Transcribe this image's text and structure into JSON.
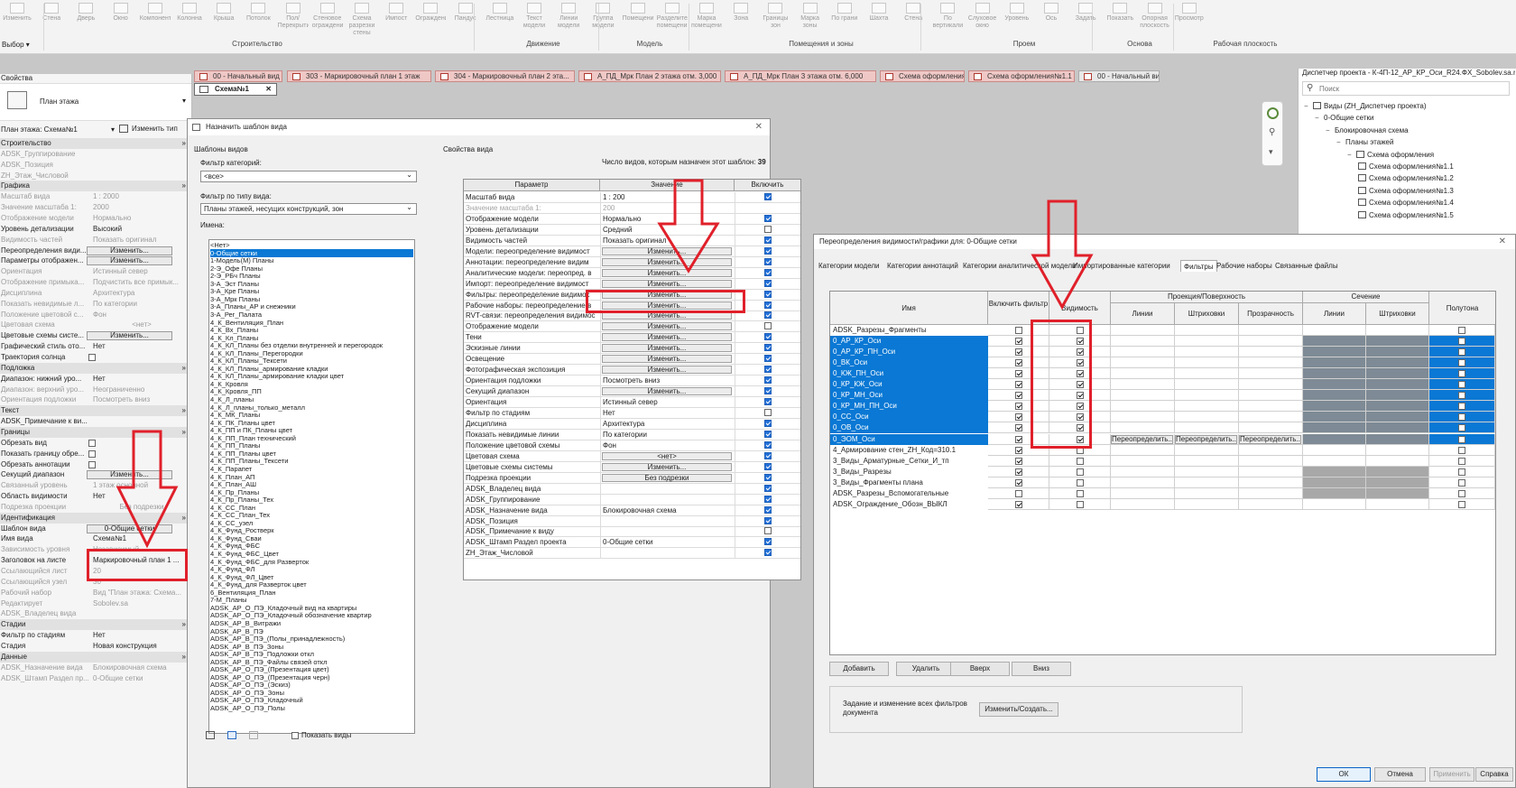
{
  "ribbon": {
    "tools": [
      "Изменить",
      "Стена",
      "Дверь",
      "Окно",
      "Компонент",
      "Колонна",
      "Крыша",
      "Потолок",
      "Пол/Перекрытие",
      "Стеновое ограждение",
      "Схема разрезки стены",
      "Импост",
      "Ограждение",
      "Пандус",
      "Лестница",
      "Текст модели",
      "Линии модели",
      "Группа модели",
      "Помещение",
      "Разделитель помещений",
      "Марка помещения",
      "Зона",
      "Границы зон",
      "Марка зоны",
      "По грани",
      "Шахта",
      "Стена",
      "По вертикали",
      "Слуховое окно",
      "Уровень",
      "Ось",
      "Задать",
      "Показать",
      "Опорная плоскость",
      "Просмотр"
    ],
    "select_label": "Выбор",
    "panels": [
      "Строительство",
      "Движение",
      "Модель",
      "Помещения и зоны",
      "Проем",
      "Основа",
      "Рабочая плоскость"
    ]
  },
  "tabs": [
    "00 - Начальный вид",
    "303 - Маркировочный план 1 этаж",
    "304 - Маркировочный план 2 эта...",
    "А_ПД_Мрк План 2 этажа отм. 3,000",
    "А_ПД_Мрк План 3 этажа отм. 6,000",
    "Схема оформления",
    "Схема оформления№1.1",
    "00 - Начальный вид"
  ],
  "active_tab": "Схема№1",
  "properties": {
    "title": "Свойства",
    "type_name": "План этажа",
    "instance_label": "План этажа: Схема№1",
    "edit_type": "Изменить тип",
    "rows": [
      {
        "t": "sec",
        "k": "Строительство"
      },
      {
        "t": "row",
        "k": "ADSK_Группирование",
        "v": "",
        "dis": true
      },
      {
        "t": "row",
        "k": "ADSK_Позиция",
        "v": "",
        "dis": true
      },
      {
        "t": "row",
        "k": "ZH_Этаж_Числовой",
        "v": "",
        "dis": true
      },
      {
        "t": "sec",
        "k": "Графика"
      },
      {
        "t": "row",
        "k": "Масштаб вида",
        "v": "1 : 2000",
        "dis": true
      },
      {
        "t": "row",
        "k": "Значение масштаба    1:",
        "v": "2000",
        "dis": true
      },
      {
        "t": "row",
        "k": "Отображение модели",
        "v": "Нормально",
        "dis": true
      },
      {
        "t": "row",
        "k": "Уровень детализации",
        "v": "Высокий",
        "dis": false
      },
      {
        "t": "row",
        "k": "Видимость частей",
        "v": "Показать оригинал",
        "dis": true
      },
      {
        "t": "btn",
        "k": "Переопределения види...",
        "v": "Изменить..."
      },
      {
        "t": "btn",
        "k": "Параметры отображен...",
        "v": "Изменить..."
      },
      {
        "t": "row",
        "k": "Ориентация",
        "v": "Истинный север",
        "dis": true
      },
      {
        "t": "row",
        "k": "Отображение примыка...",
        "v": "Подчистить все примык...",
        "dis": true
      },
      {
        "t": "row",
        "k": "Дисциплина",
        "v": "Архитектура",
        "dis": true
      },
      {
        "t": "row",
        "k": "Показать невидимые л...",
        "v": "По категории",
        "dis": true
      },
      {
        "t": "row",
        "k": "Положение цветовой с...",
        "v": "Фон",
        "dis": true
      },
      {
        "t": "row",
        "k": "Цветовая схема",
        "v": "<нет>",
        "dis": true,
        "center": true
      },
      {
        "t": "btn",
        "k": "Цветовые схемы систе...",
        "v": "Изменить..."
      },
      {
        "t": "row",
        "k": "Графический стиль отo...",
        "v": "Нет",
        "dis": false
      },
      {
        "t": "chk",
        "k": "Траектория солнца",
        "v": ""
      },
      {
        "t": "sec",
        "k": "Подложка"
      },
      {
        "t": "row",
        "k": "Диапазон: нижний уро...",
        "v": "Нет",
        "dis": false
      },
      {
        "t": "row",
        "k": "Диапазон: верхний уро...",
        "v": "Неограниченно",
        "dis": true
      },
      {
        "t": "row",
        "k": "Ориентация подложки",
        "v": "Посмотреть вниз",
        "dis": true
      },
      {
        "t": "sec",
        "k": "Текст"
      },
      {
        "t": "row",
        "k": "ADSK_Примечание к ви...",
        "v": "",
        "dis": false
      },
      {
        "t": "sec",
        "k": "Границы"
      },
      {
        "t": "chk",
        "k": "Обрезать вид",
        "v": ""
      },
      {
        "t": "chk",
        "k": "Показать границу обре...",
        "v": ""
      },
      {
        "t": "chk",
        "k": "Обрезать аннотации",
        "v": ""
      },
      {
        "t": "btn",
        "k": "Секущий диапазон",
        "v": "Изменить..."
      },
      {
        "t": "row",
        "k": "Связанный уровень",
        "v": "1 этаж основной",
        "dis": true
      },
      {
        "t": "row",
        "k": "Область видимости",
        "v": "Нет",
        "dis": false
      },
      {
        "t": "row",
        "k": "Подрезка проекции",
        "v": "Без подрезки",
        "dis": true,
        "center": true
      },
      {
        "t": "sec",
        "k": "Идентификация"
      },
      {
        "t": "btn",
        "k": "Шаблон вида",
        "v": "0-Общие сетки"
      },
      {
        "t": "row",
        "k": "Имя вида",
        "v": "Схема№1",
        "dis": false
      },
      {
        "t": "row",
        "k": "Зависимость уровня",
        "v": "Независимый",
        "dis": true
      },
      {
        "t": "row",
        "k": "Заголовок на листе",
        "v": "Маркировочный план 1 ...",
        "dis": false
      },
      {
        "t": "row",
        "k": "Ссылающийся лист",
        "v": "20",
        "dis": true
      },
      {
        "t": "row",
        "k": "Ссылающийся узел",
        "v": "30",
        "dis": true
      },
      {
        "t": "row",
        "k": "Рабочий набор",
        "v": "Вид \"План этажа: Схема...",
        "dis": true
      },
      {
        "t": "row",
        "k": "Редактирует",
        "v": "Sobolev.sa",
        "dis": true
      },
      {
        "t": "row",
        "k": "ADSK_Владелец вида",
        "v": "",
        "dis": true
      },
      {
        "t": "sec",
        "k": "Стадии"
      },
      {
        "t": "row",
        "k": "Фильтр по стадиям",
        "v": "Нет",
        "dis": false
      },
      {
        "t": "row",
        "k": "Стадия",
        "v": "Новая конструкция",
        "dis": false
      },
      {
        "t": "sec",
        "k": "Данные"
      },
      {
        "t": "row",
        "k": "ADSK_Назначение вида",
        "v": "Блокировочная схема",
        "dis": true
      },
      {
        "t": "row",
        "k": "ADSK_Штамп Раздел пр...",
        "v": "0-Общие сетки",
        "dis": true
      }
    ]
  },
  "dialog_template": {
    "title": "Назначить шаблон вида",
    "templates_label": "Шаблоны видов",
    "filter_cat_label": "Фильтр категорий:",
    "filter_cat_value": "<все>",
    "filter_type_label": "Фильтр по типу вида:",
    "filter_type_value": "Планы этажей, несущих конструкций, зон",
    "names_label": "Имена:",
    "names": [
      "<Нет>",
      "0-Общие сетки",
      "1-Модель(М) Планы",
      "2-Э_Офе Планы",
      "2-Э_РБч Планы",
      "3-А_Эст Планы",
      "3-А_Кре Планы",
      "3-А_Мрк Планы",
      "3-А_Планы_АР и снежники",
      "3-А_Рег_Палата",
      "4_К_Вентиляция_План",
      "4_К_Вх_Планы",
      "4_К_Кл_Планы",
      "4_К_КЛ_Планы без отделки внутренней и перегородок",
      "4_К_КЛ_Планы_Перегородки",
      "4_К_КЛ_Планы_Тексети",
      "4_К_КЛ_Планы_армирование кладки",
      "4_К_КЛ_Планы_армирование кладки цвет",
      "4_К_Кровля",
      "4_К_Кровля_ПП",
      "4_К_Л_планы",
      "4_К_Л_планы_только_металл",
      "4_К_МК_Планы",
      "4_К_ПК_Планы цвет",
      "4_К_ПП и ПК_Планы цвет",
      "4_К_ПП_План технический",
      "4_К_ПП_Планы",
      "4_К_ПП_Планы цвет",
      "4_К_ПП_Планы_Тексети",
      "4_К_Парапет",
      "4_К_План_АП",
      "4_К_План_АШ",
      "4_К_Пр_Планы",
      "4_К_Пр_Планы_Тех",
      "4_К_СС_План",
      "4_К_СС_План_Тех",
      "4_К_СС_узел",
      "4_К_Фунд_Ростверк",
      "4_К_Фунд_Сваи",
      "4_К_Фунд_ФБС",
      "4_К_Фунд_ФБС_Цвет",
      "4_К_Фунд_ФБС_для Разверток",
      "4_К_Фунд_ФЛ",
      "4_К_Фунд_ФЛ_Цвет",
      "4_К_Фунд_для Разверток цвет",
      "6_Вентиляция_План",
      "7-М_Планы",
      "ADSK_АР_О_ПЭ_Кладочный вид на квартиры",
      "ADSK_АР_О_ПЭ_Кладочный обозначение квартир",
      "ADSK_АР_В_Витражи",
      "ADSK_АР_В_ПЭ",
      "ADSK_АР_В_ПЭ_(Полы_принадлежность)",
      "ADSK_АР_В_ПЭ_Зоны",
      "ADSK_АР_В_ПЭ_Подложки откл",
      "ADSK_АР_В_ПЭ_Файлы связей откл",
      "ADSK_АР_О_ПЭ_(Презентация цвет)",
      "ADSK_АР_О_ПЭ_(Презентация черн)",
      "ADSK_АР_О_ПЭ_(Эскиз)",
      "ADSK_АР_О_ПЭ_Зоны",
      "ADSK_АР_О_ПЭ_Кладочный",
      "ADSK_АР_О_ПЭ_Полы"
    ],
    "selected_index": 1,
    "show_views": "Показать виды",
    "props_label": "Свойства вида",
    "count_label": "Число видов, которым назначен этот шаблон:",
    "count_value": "39",
    "col_param": "Параметр",
    "col_value": "Значение",
    "col_include": "Включить",
    "rows": [
      {
        "p": "Масштаб вида",
        "v": "1 : 200",
        "btn": false,
        "inc": true,
        "dis": false
      },
      {
        "p": "Значение масштаба    1:",
        "v": "200",
        "btn": false,
        "inc": false,
        "dis": true,
        "noinc": true
      },
      {
        "p": "Отображение модели",
        "v": "Нормально",
        "btn": false,
        "inc": true,
        "dis": false
      },
      {
        "p": "Уровень детализации",
        "v": "Средний",
        "btn": false,
        "inc": false,
        "dis": false
      },
      {
        "p": "Видимость частей",
        "v": "Показать оригинал",
        "btn": false,
        "inc": true,
        "dis": false
      },
      {
        "p": "Модели: переопределение видимост",
        "v": "Изменить...",
        "btn": true,
        "inc": true,
        "dis": false
      },
      {
        "p": "Аннотации: переопределение видим",
        "v": "Изменить...",
        "btn": true,
        "inc": true,
        "dis": false
      },
      {
        "p": "Аналитические модели: переопред. в",
        "v": "Изменить...",
        "btn": true,
        "inc": true,
        "dis": false
      },
      {
        "p": "Импорт: переопределение видимост",
        "v": "Изменить...",
        "btn": true,
        "inc": true,
        "dis": false
      },
      {
        "p": "Фильтры: переопределение видимос",
        "v": "Изменить...",
        "btn": true,
        "inc": true,
        "dis": false
      },
      {
        "p": "Рабочие наборы: переопределение в",
        "v": "Изменить...",
        "btn": true,
        "inc": true,
        "dis": false
      },
      {
        "p": "RVT-связи: переопределения видимос",
        "v": "Изменить...",
        "btn": true,
        "inc": true,
        "dis": false
      },
      {
        "p": "Отображение модели",
        "v": "Изменить...",
        "btn": true,
        "inc": false,
        "dis": false
      },
      {
        "p": "Тени",
        "v": "Изменить...",
        "btn": true,
        "inc": true,
        "dis": false
      },
      {
        "p": "Эскизные линии",
        "v": "Изменить...",
        "btn": true,
        "inc": true,
        "dis": false
      },
      {
        "p": "Освещение",
        "v": "Изменить...",
        "btn": true,
        "inc": true,
        "dis": false
      },
      {
        "p": "Фотографическая экспозиция",
        "v": "Изменить...",
        "btn": true,
        "inc": true,
        "dis": false
      },
      {
        "p": "Ориентация подложки",
        "v": "Посмотреть вниз",
        "btn": false,
        "inc": true,
        "dis": false
      },
      {
        "p": "Секущий диапазон",
        "v": "Изменить...",
        "btn": true,
        "inc": true,
        "dis": false
      },
      {
        "p": "Ориентация",
        "v": "Истинный север",
        "btn": false,
        "inc": true,
        "dis": false
      },
      {
        "p": "Фильтр по стадиям",
        "v": "Нет",
        "btn": false,
        "inc": false,
        "dis": false
      },
      {
        "p": "Дисциплина",
        "v": "Архитектура",
        "btn": false,
        "inc": true,
        "dis": false
      },
      {
        "p": "Показать невидимые линии",
        "v": "По категории",
        "btn": false,
        "inc": true,
        "dis": false
      },
      {
        "p": "Положение цветовой схемы",
        "v": "Фон",
        "btn": false,
        "inc": true,
        "dis": false
      },
      {
        "p": "Цветовая схема",
        "v": "<нет>",
        "btn": true,
        "inc": true,
        "dis": false
      },
      {
        "p": "Цветовые схемы системы",
        "v": "Изменить...",
        "btn": true,
        "inc": true,
        "dis": false
      },
      {
        "p": "Подрезка проекции",
        "v": "Без подрезки",
        "btn": true,
        "inc": true,
        "dis": false
      },
      {
        "p": "ADSK_Владелец вида",
        "v": "",
        "btn": false,
        "inc": true,
        "dis": false
      },
      {
        "p": "ADSK_Группирование",
        "v": "",
        "btn": false,
        "inc": true,
        "dis": false
      },
      {
        "p": "ADSK_Назначение вида",
        "v": "Блокировочная схема",
        "btn": false,
        "inc": true,
        "dis": false
      },
      {
        "p": "ADSK_Позиция",
        "v": "",
        "btn": false,
        "inc": true,
        "dis": false
      },
      {
        "p": "ADSK_Примечание к виду",
        "v": "",
        "btn": false,
        "inc": false,
        "dis": false
      },
      {
        "p": "ADSK_Штамп Раздел проекта",
        "v": "0-Общие сетки",
        "btn": false,
        "inc": true,
        "dis": false
      },
      {
        "p": "ZH_Этаж_Числовой",
        "v": "",
        "btn": false,
        "inc": true,
        "dis": false
      }
    ]
  },
  "dialog_vg": {
    "title": "Переопределения видимости/графики для: 0-Общие сетки",
    "tabs": [
      "Категории модели",
      "Категории аннотаций",
      "Категории аналитической модели",
      "Импортированные категории",
      "Фильтры",
      "Рабочие наборы",
      "Связанные файлы"
    ],
    "active_tab": 4,
    "h_name": "Имя",
    "h_enable": "Включить фильтр",
    "h_visibility": "Видимость",
    "h_projection": "Проекция/Поверхность",
    "h_cut": "Сечение",
    "h_halftone": "Полутона",
    "h_lines": "Линии",
    "h_patterns": "Штриховки",
    "h_transparency": "Прозрачность",
    "override_label": "Переопределить...",
    "filters": [
      {
        "name": "ADSK_Разрезы_Фрагменты",
        "enable": false,
        "vis": false,
        "sel": false,
        "grey": false
      },
      {
        "name": "0_АР_КР_Оси",
        "enable": true,
        "vis": true,
        "sel": true,
        "grey": true
      },
      {
        "name": "0_АР_КР_ПН_Оси",
        "enable": true,
        "vis": true,
        "sel": true,
        "grey": true
      },
      {
        "name": "0_ВК_Оси",
        "enable": true,
        "vis": true,
        "sel": true,
        "grey": true
      },
      {
        "name": "0_КЖ_ПН_Оси",
        "enable": true,
        "vis": true,
        "sel": true,
        "grey": true
      },
      {
        "name": "0_КР_КЖ_Оси",
        "enable": true,
        "vis": true,
        "sel": true,
        "grey": true
      },
      {
        "name": "0_КР_МН_Оси",
        "enable": true,
        "vis": true,
        "sel": true,
        "grey": true
      },
      {
        "name": "0_КР_МН_ПН_Оси",
        "enable": true,
        "vis": true,
        "sel": true,
        "grey": true
      },
      {
        "name": "0_СС_Оси",
        "enable": true,
        "vis": true,
        "sel": true,
        "grey": true
      },
      {
        "name": "0_ОВ_Оси",
        "enable": true,
        "vis": true,
        "sel": true,
        "grey": true
      },
      {
        "name": "0_ЭОМ_Оси",
        "enable": true,
        "vis": true,
        "sel": true,
        "grey": true,
        "override": true
      },
      {
        "name": "4_Армирование стен_ZH_Код=310.1",
        "enable": true,
        "vis": false,
        "sel": false,
        "grey": false
      },
      {
        "name": "3_Виды_Арматурные_Сетки_И_тп",
        "enable": true,
        "vis": false,
        "sel": false,
        "grey": false
      },
      {
        "name": "3_Виды_Разрезы",
        "enable": true,
        "vis": false,
        "sel": false,
        "grey": true
      },
      {
        "name": "3_Виды_Фрагменты плана",
        "enable": true,
        "vis": false,
        "sel": false,
        "grey": true
      },
      {
        "name": "ADSK_Разрезы_Вспомогательные",
        "enable": false,
        "vis": false,
        "sel": false,
        "grey": true
      },
      {
        "name": "ADSK_Ограждение_Обозн_ВЫКЛ",
        "enable": true,
        "vis": false,
        "sel": false,
        "grey": false
      }
    ],
    "btn_add": "Добавить",
    "btn_delete": "Удалить",
    "btn_up": "Вверх",
    "btn_down": "Вниз",
    "edit_all_text": "Задание и изменение всех фильтров документа",
    "btn_edit_create": "Изменить/Создать...",
    "btn_ok": "ОК",
    "btn_cancel": "Отмена",
    "btn_apply": "Применить",
    "btn_help": "Справка"
  },
  "browser": {
    "title": "Диспетчер проекта - К-4П-12_АР_КР_Оси_R24.ФХ_Sobolev.sa.rvt",
    "search_placeholder": "Поиск",
    "nodes": [
      {
        "label": "Виды (ZH_Диспетчер проекта)",
        "level": 0
      },
      {
        "label": "0-Общие сетки",
        "level": 1
      },
      {
        "label": "Блокировочная схема",
        "level": 2
      },
      {
        "label": "Планы этажей",
        "level": 3
      },
      {
        "label": "Схема оформления",
        "level": 4
      },
      {
        "label": "Схема оформления№1.1",
        "level": 5
      },
      {
        "label": "Схема оформления№1.2",
        "level": 5
      },
      {
        "label": "Схема оформления№1.3",
        "level": 5
      },
      {
        "label": "Схема оформления№1.4",
        "level": 5
      },
      {
        "label": "Схема оформления№1.5",
        "level": 5
      }
    ]
  },
  "colors": {
    "accent": "#0a78d4",
    "annotation": "#e0202a"
  }
}
